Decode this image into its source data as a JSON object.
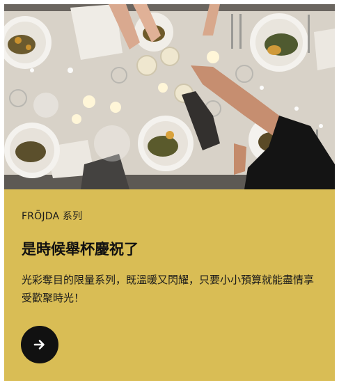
{
  "promo": {
    "image_alt": "People toasting with champagne glasses over a festive dinner table",
    "eyebrow": "FRÖJDA 系列",
    "headline": "是時候舉杯慶祝了",
    "body": "光彩奪目的限量系列，既溫暖又閃耀，只要小小預算就能盡情享受歡聚時光！",
    "cta_icon": "arrow-right-icon",
    "colors": {
      "panel": "#d9bd55",
      "button": "#111111",
      "button_icon": "#ffffff",
      "text": "#111111"
    }
  }
}
